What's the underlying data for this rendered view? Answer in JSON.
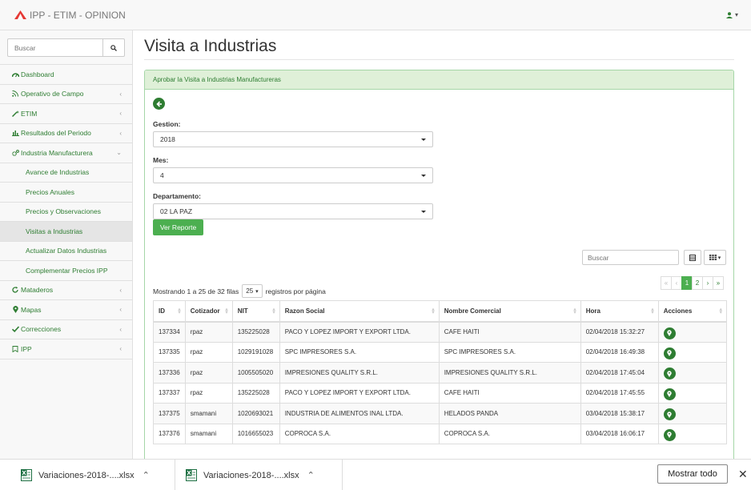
{
  "app": {
    "brand": "IPP - ETIM - OPINION",
    "user_caret": "▾"
  },
  "sidebar": {
    "search_placeholder": "Buscar",
    "items": [
      {
        "label": "Dashboard",
        "icon": "dashboard-icon"
      },
      {
        "label": "Operativo de Campo",
        "icon": "rss-icon"
      },
      {
        "label": "ETIM",
        "icon": "magic-icon"
      },
      {
        "label": "Resultados del Periodo",
        "icon": "bar-chart-icon"
      },
      {
        "label": "Industria Manufacturera",
        "icon": "cogs-icon"
      }
    ],
    "subitems": [
      {
        "label": "Avance de Industrias"
      },
      {
        "label": "Precios Anuales"
      },
      {
        "label": "Precios y Observaciones"
      },
      {
        "label": "Visitas a Industrias",
        "active": true
      },
      {
        "label": "Actualizar Datos Industrias"
      },
      {
        "label": "Complementar Precios IPP"
      }
    ],
    "items_after": [
      {
        "label": "Mataderos",
        "icon": "refresh-icon"
      },
      {
        "label": "Mapas",
        "icon": "map-marker-icon"
      },
      {
        "label": "Correcciones",
        "icon": "check-icon"
      },
      {
        "label": "IPP",
        "icon": "bookmark-icon"
      }
    ]
  },
  "main": {
    "title": "Visita a Industrias",
    "panel_heading": "Aprobar la Visita a Industrias Manufactureras",
    "filters": [
      {
        "label": "Gestion:",
        "value": "2018"
      },
      {
        "label": "Mes:",
        "value": "4"
      },
      {
        "label": "Departamento:",
        "value": "02 LA PAZ"
      }
    ],
    "report_button": "Ver Reporte",
    "table_search_placeholder": "Buscar",
    "info": {
      "showing": "Mostrando 1 a 25 de 32 filas",
      "page_size": "25",
      "per_page": "registros por página"
    },
    "pagination": [
      "«",
      "‹",
      "1",
      "2",
      "›",
      "»"
    ],
    "columns": [
      "ID",
      "Cotizador",
      "NIT",
      "Razon Social",
      "Nombre Comercial",
      "Hora",
      "Acciones"
    ],
    "rows": [
      [
        "137334",
        "rpaz",
        "135225028",
        "PACO Y LOPEZ IMPORT Y EXPORT LTDA.",
        "CAFE HAITI",
        "02/04/2018 15:32:27"
      ],
      [
        "137335",
        "rpaz",
        "1029191028",
        "SPC IMPRESORES S.A.",
        "SPC IMPRESORES S.A.",
        "02/04/2018 16:49:38"
      ],
      [
        "137336",
        "rpaz",
        "1005505020",
        "IMPRESIONES QUALITY S.R.L.",
        "IMPRESIONES QUALITY S.R.L.",
        "02/04/2018 17:45:04"
      ],
      [
        "137337",
        "rpaz",
        "135225028",
        "PACO Y LOPEZ IMPORT Y EXPORT LTDA.",
        "CAFE HAITI",
        "02/04/2018 17:45:55"
      ],
      [
        "137375",
        "smamani",
        "1020693021",
        "INDUSTRIA DE ALIMENTOS INAL LTDA.",
        "HELADOS PANDA",
        "03/04/2018 15:38:17"
      ],
      [
        "137376",
        "smamani",
        "1016655023",
        "COPROCA S.A.",
        "COPROCA S.A.",
        "03/04/2018 16:06:17"
      ]
    ]
  },
  "downloads": {
    "files": [
      "Variaciones-2018-....xlsx",
      "Variaciones-2018-....xlsx"
    ],
    "show_all": "Mostrar todo",
    "close": "✕"
  },
  "colors": {
    "accent": "#2e7d32",
    "button": "#4caf50",
    "panel_heading_bg": "#dff0d8",
    "brand_logo": "#e53935"
  }
}
